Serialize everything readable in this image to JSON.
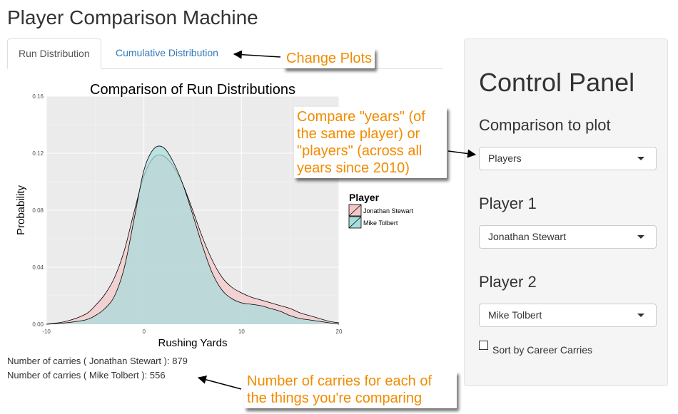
{
  "app": {
    "title": "Player Comparison Machine"
  },
  "tabs": [
    {
      "label": "Run Distribution",
      "active": true
    },
    {
      "label": "Cumulative Distribution",
      "active": false
    }
  ],
  "chart_data": {
    "type": "area",
    "title": "Comparison of Run Distributions",
    "xlabel": "Rushing Yards",
    "ylabel": "Probability",
    "xlim": [
      -10,
      20
    ],
    "ylim": [
      0,
      0.16
    ],
    "x_ticks": [
      "-10",
      "0",
      "10",
      "20"
    ],
    "y_ticks": [
      "0.00",
      "0.04",
      "0.08",
      "0.12",
      "0.16"
    ],
    "legend_title": "Player",
    "legend_position": "right",
    "grid": true,
    "x": [
      -10,
      -8,
      -6,
      -5,
      -4,
      -3,
      -2,
      -1,
      0,
      1,
      2,
      3,
      4,
      5,
      6,
      7,
      8,
      9,
      10,
      11,
      12,
      13,
      14,
      15,
      16,
      17,
      18,
      19,
      20
    ],
    "series": [
      {
        "name": "Jonathan Stewart",
        "color": "#f4c6c6",
        "values": [
          0.0,
          0.002,
          0.007,
          0.013,
          0.021,
          0.033,
          0.052,
          0.079,
          0.104,
          0.117,
          0.118,
          0.111,
          0.098,
          0.08,
          0.061,
          0.045,
          0.033,
          0.026,
          0.022,
          0.019,
          0.017,
          0.015,
          0.013,
          0.011,
          0.008,
          0.006,
          0.004,
          0.002,
          0.001
        ]
      },
      {
        "name": "Mike Tolbert",
        "color": "#a7dcdc",
        "values": [
          0.0,
          0.001,
          0.003,
          0.006,
          0.011,
          0.02,
          0.04,
          0.074,
          0.108,
          0.123,
          0.124,
          0.114,
          0.098,
          0.077,
          0.055,
          0.036,
          0.024,
          0.018,
          0.015,
          0.014,
          0.013,
          0.011,
          0.009,
          0.006,
          0.004,
          0.003,
          0.002,
          0.001,
          0.0
        ]
      }
    ]
  },
  "stats": {
    "line1": "Number of carries ( Jonathan Stewart ): 879",
    "line2": "Number of carries ( Mike Tolbert ): 556"
  },
  "panel": {
    "title": "Control Panel",
    "comparison_label": "Comparison to plot",
    "comparison_value": "Players",
    "player1_label": "Player 1",
    "player1_value": "Jonathan Stewart",
    "player2_label": "Player 2",
    "player2_value": "Mike Tolbert",
    "sort_label": "Sort by Career Carries",
    "sort_checked": false
  },
  "annotations": {
    "change_plots": "Change Plots",
    "compare_line1": "Compare \"years\" (of",
    "compare_line2": "the same player) or",
    "compare_line3": "\"players\" (across all",
    "compare_line4": "years since 2010)",
    "carries_line1": "Number of carries for each of",
    "carries_line2": "the things you're comparing",
    "color": "#f28b00"
  }
}
